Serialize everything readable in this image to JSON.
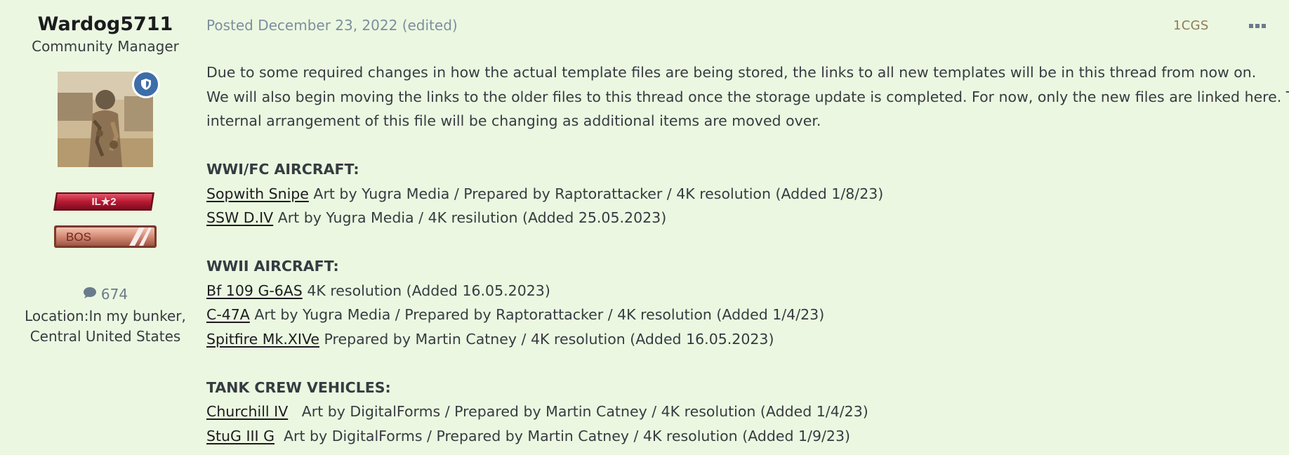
{
  "author": {
    "name": "Wardog5711",
    "title": "Community Manager",
    "post_count": "674",
    "location_line1": "Location:In my bunker,",
    "location_line2": "Central United States",
    "award_1_text": "IL★2",
    "award_2_text": "BOS"
  },
  "post": {
    "meta": "Posted December 23, 2022 (edited)",
    "tag": "1CGS",
    "intro_1": "Due to some required changes in how the actual template files are being stored, the links to all new templates will be in this thread from now on.",
    "intro_2": "We will also begin moving the links to the older files to this thread once the storage update is completed.  For now, only the new files are linked here. The",
    "intro_3": "internal arrangement of this file will be changing as additional items are moved over.",
    "sections": [
      {
        "heading": "WWI/FC AIRCRAFT:",
        "items": [
          {
            "link": "Sopwith Snipe",
            "text": "  Art by Yugra Media / Prepared by Raptorattacker / 4K resolution (Added 1/8/23)"
          },
          {
            "link": "SSW D.IV",
            "text": " Art by Yugra Media / 4K resilution (Added 25.05.2023)"
          }
        ]
      },
      {
        "heading": "WWII AIRCRAFT:",
        "items": [
          {
            "link": "Bf 109 G-6AS",
            "text": " 4K resolution (Added 16.05.2023)"
          },
          {
            "link": "C-47A",
            "text": " Art by Yugra Media / Prepared by Raptorattacker / 4K resolution (Added 1/4/23)"
          },
          {
            "link": "Spitfire Mk.XIVe",
            "text": " Prepared by Martin Catney / 4K resolution (Added 16.05.2023)"
          }
        ]
      },
      {
        "heading": "TANK CREW VEHICLES:",
        "items": [
          {
            "link": "Churchill IV",
            "text": "   Art by DigitalForms / Prepared by Martin Catney / 4K resolution (Added 1/4/23)"
          },
          {
            "link": "StuG III G",
            "text": "  Art by DigitalForms / Prepared by Martin Catney / 4K resolution (Added 1/9/23)"
          }
        ]
      }
    ]
  },
  "icons": {
    "moderator_badge": "shield-icon",
    "post_count": "speech-bubble-icon",
    "more": "ellipsis-icon"
  },
  "colors": {
    "background": "#ecf7e1",
    "badge": "#3d6ea8",
    "meta": "#7c8f9f",
    "tag": "#8d7c58"
  }
}
